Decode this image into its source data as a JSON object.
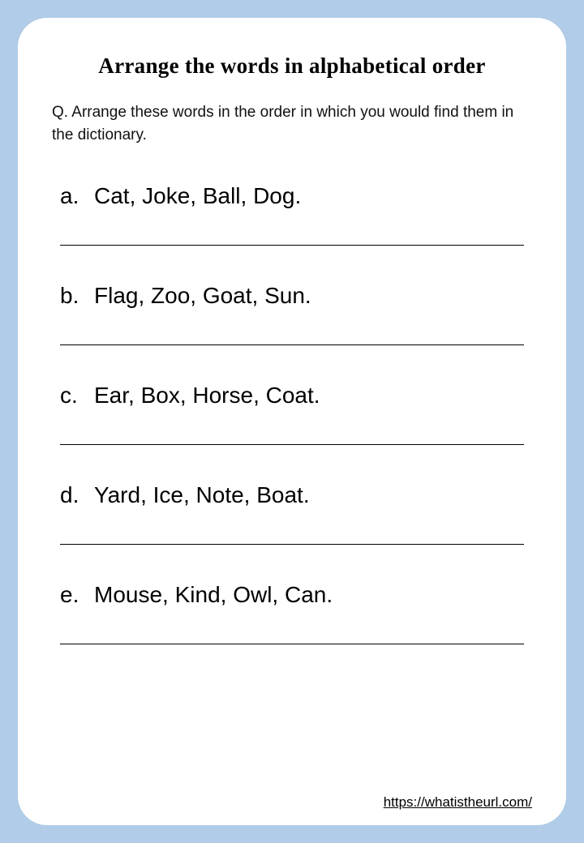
{
  "title": "Arrange the words in alphabetical order",
  "instruction": "Q. Arrange these words in the order in which you would find them in the dictionary.",
  "items": [
    {
      "letter": "a.",
      "words": "Cat, Joke, Ball, Dog."
    },
    {
      "letter": "b.",
      "words": "Flag, Zoo, Goat, Sun."
    },
    {
      "letter": "c.",
      "words": "Ear, Box, Horse, Coat."
    },
    {
      "letter": "d.",
      "words": "Yard, Ice, Note, Boat."
    },
    {
      "letter": "e.",
      "words": "Mouse, Kind, Owl, Can."
    }
  ],
  "source_url": "https://whatistheurl.com/"
}
